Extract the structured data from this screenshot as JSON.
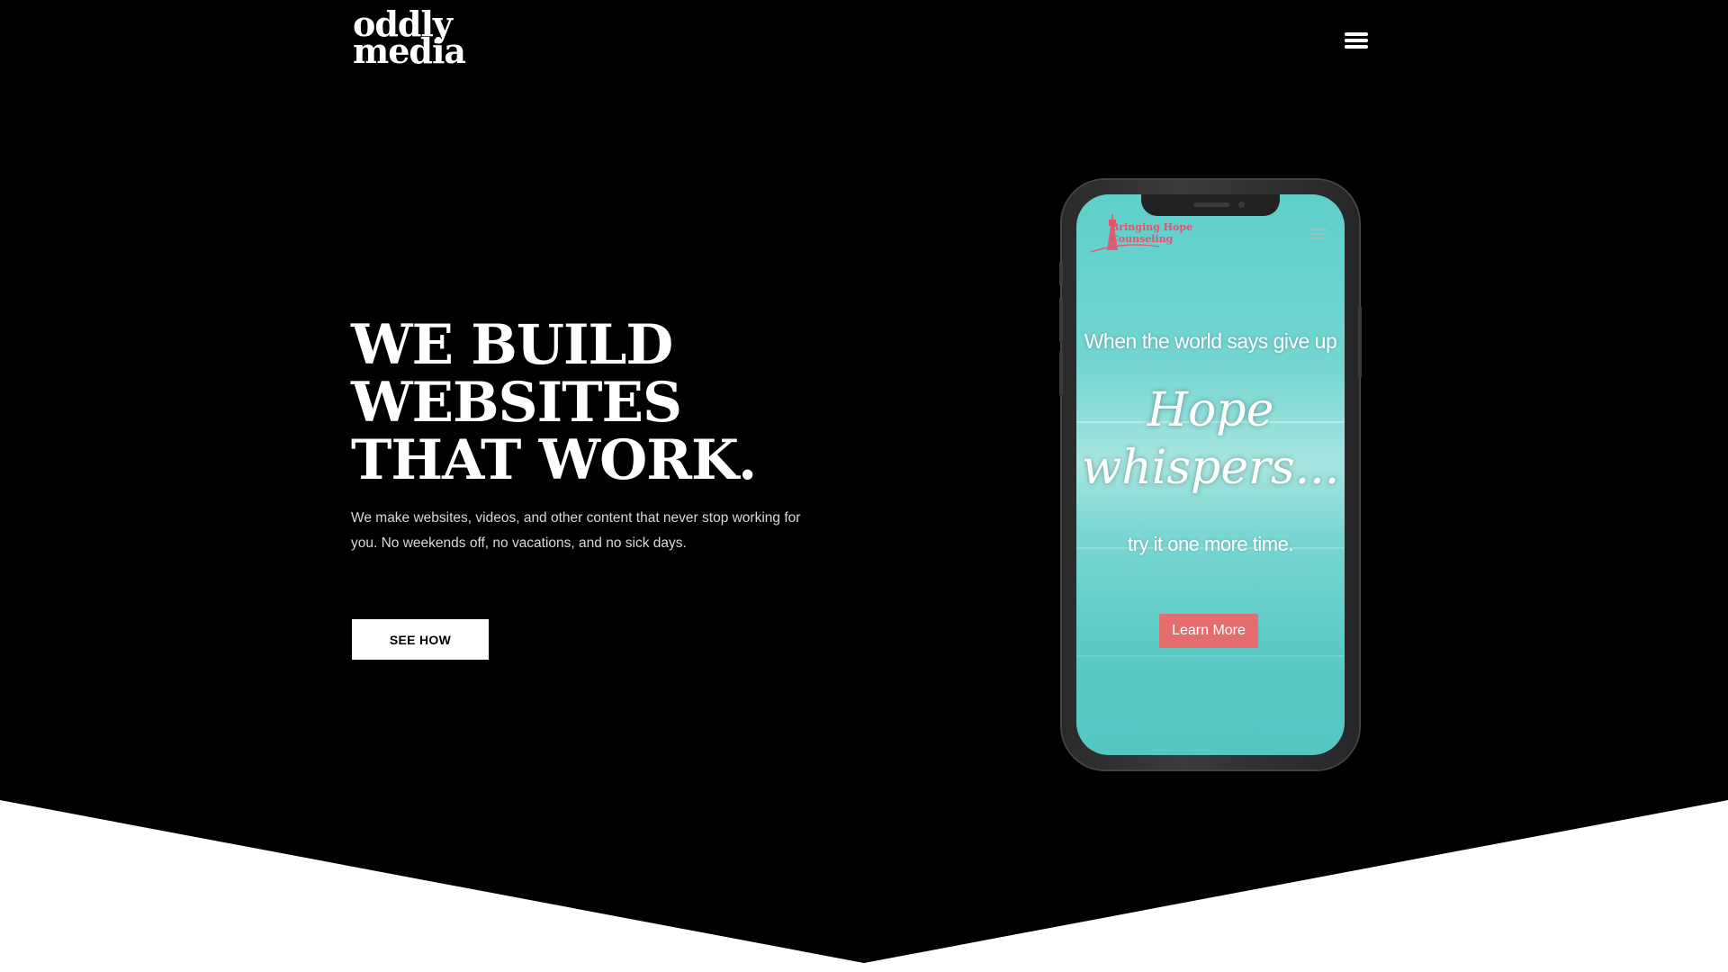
{
  "logo": {
    "line1": "oddly",
    "line2": "media"
  },
  "nav": {
    "menu_icon": "hamburger-menu-icon"
  },
  "hero": {
    "headline_lines": [
      "WE BUILD",
      "WEBSITES",
      "THAT WORK."
    ],
    "subtext": "We make websites, videos, and other content that never stop working for you.  No weekends off, no vacations, and no sick days.",
    "cta_label": "SEE HOW"
  },
  "phone_mockup": {
    "site_logo": {
      "icon": "lighthouse-icon",
      "line1": "Bringing Hope",
      "line2": "Counseling"
    },
    "site_menu_icon": "hamburger-menu-icon",
    "line1": "When the world says give up",
    "script_lines": [
      "Hope",
      "whispers..."
    ],
    "line2": "try it one more time.",
    "button_label": "Learn More"
  },
  "colors": {
    "background": "#000000",
    "lower_section": "#ffffff",
    "cta_bg": "#ffffff",
    "phone_screen": "#5ecfca",
    "phone_button": "#e46d6f",
    "phone_logo_text": "#e8506a"
  }
}
